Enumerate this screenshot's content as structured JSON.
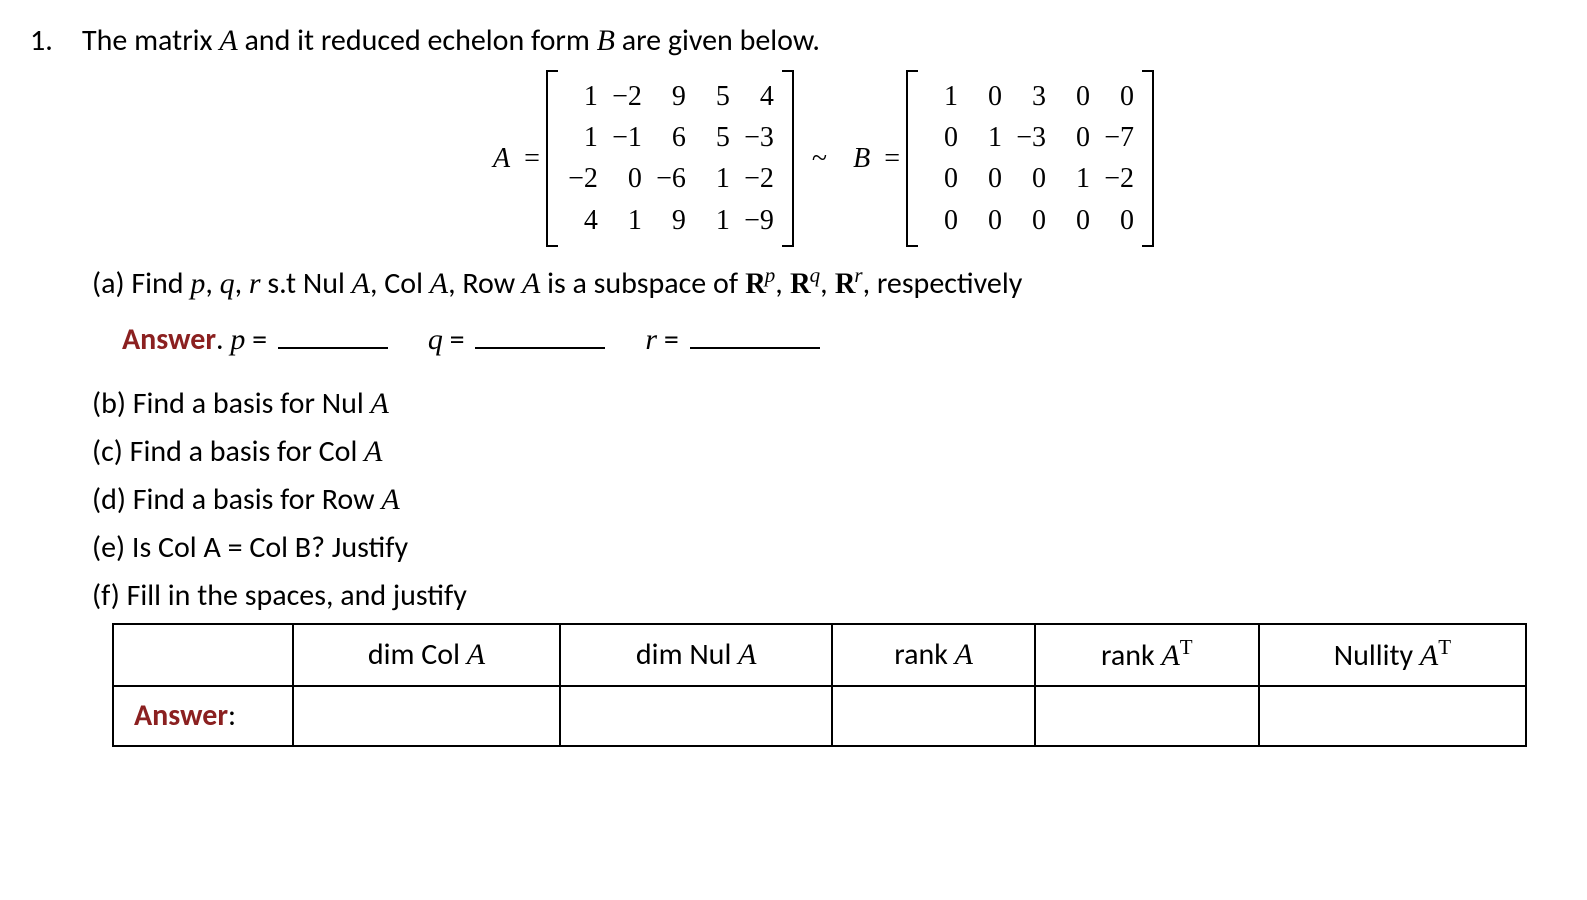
{
  "problem_number": "1.",
  "intro_prefix": "The matrix ",
  "intro_varA": "A",
  "intro_mid": " and it reduced echelon form ",
  "intro_varB": "B",
  "intro_suffix": " are given below.",
  "matA_label": "A",
  "matB_label": "B",
  "equals": "=",
  "tilde": "~",
  "matrixA": [
    [
      "1",
      "−2",
      "9",
      "5",
      "4"
    ],
    [
      "1",
      "−1",
      "6",
      "5",
      "−3"
    ],
    [
      "−2",
      "0",
      "−6",
      "1",
      "−2"
    ],
    [
      "4",
      "1",
      "9",
      "1",
      "−9"
    ]
  ],
  "matrixB": [
    [
      "1",
      "0",
      "3",
      "0",
      "0"
    ],
    [
      "0",
      "1",
      "−3",
      "0",
      "−7"
    ],
    [
      "0",
      "0",
      "0",
      "1",
      "−2"
    ],
    [
      "0",
      "0",
      "0",
      "0",
      "0"
    ]
  ],
  "parts": {
    "a_label": "(a) ",
    "a_text_1": "Find ",
    "a_p": "p",
    "a_c1": ", ",
    "a_q": "q",
    "a_c2": ", ",
    "a_r": "r",
    "a_text_2": " s.t Nul ",
    "a_A1": "A",
    "a_text_3": ", Col ",
    "a_A2": "A",
    "a_text_4": ", Row ",
    "a_A3": "A",
    "a_text_5": " is a subspace of ",
    "a_Rp": "R",
    "a_sup_p": "p",
    "a_c3": ", ",
    "a_Rq": "R",
    "a_sup_q": "q",
    "a_c4": ", ",
    "a_Rr": "R",
    "a_sup_r": "r",
    "a_text_6": ", respectively",
    "answer_label": "Answer",
    "ans_dot": ". ",
    "ans_p": "p",
    "ans_eq1": " = ",
    "ans_q": "q",
    "ans_eq2": " = ",
    "ans_r": "r",
    "ans_eq3": " = ",
    "b": "(b) Find a basis for Nul ",
    "b_A": "A",
    "c": "(c) Find a basis for Col ",
    "c_A": "A",
    "d": "(d) Find a basis for Row ",
    "d_A": "A",
    "e": "(e) Is Col A = Col B? Justify",
    "f": "(f)  Fill in the spaces, and justify"
  },
  "table": {
    "h0": "",
    "h1_pre": "dim Col ",
    "h1_A": "A",
    "h2_pre": "dim Nul ",
    "h2_A": "A",
    "h3_pre": "rank ",
    "h3_A": "A",
    "h4_pre": "rank ",
    "h4_A": "A",
    "h4_sup": "T",
    "h5_pre": "Nullity ",
    "h5_A": "A",
    "h5_sup": "T",
    "r1_label": "Answer",
    "r1_colon": ":",
    "r1_c1": "",
    "r1_c2": "",
    "r1_c3": "",
    "r1_c4": "",
    "r1_c5": ""
  },
  "chart_data": {
    "type": "table",
    "matrix_A": [
      [
        1,
        -2,
        9,
        5,
        4
      ],
      [
        1,
        -1,
        6,
        5,
        -3
      ],
      [
        -2,
        0,
        -6,
        1,
        -2
      ],
      [
        4,
        1,
        9,
        1,
        -9
      ]
    ],
    "matrix_B": [
      [
        1,
        0,
        3,
        0,
        0
      ],
      [
        0,
        1,
        -3,
        0,
        -7
      ],
      [
        0,
        0,
        0,
        1,
        -2
      ],
      [
        0,
        0,
        0,
        0,
        0
      ]
    ],
    "answer_table_headers": [
      "",
      "dim Col A",
      "dim Nul A",
      "rank A",
      "rank A^T",
      "Nullity A^T"
    ]
  }
}
